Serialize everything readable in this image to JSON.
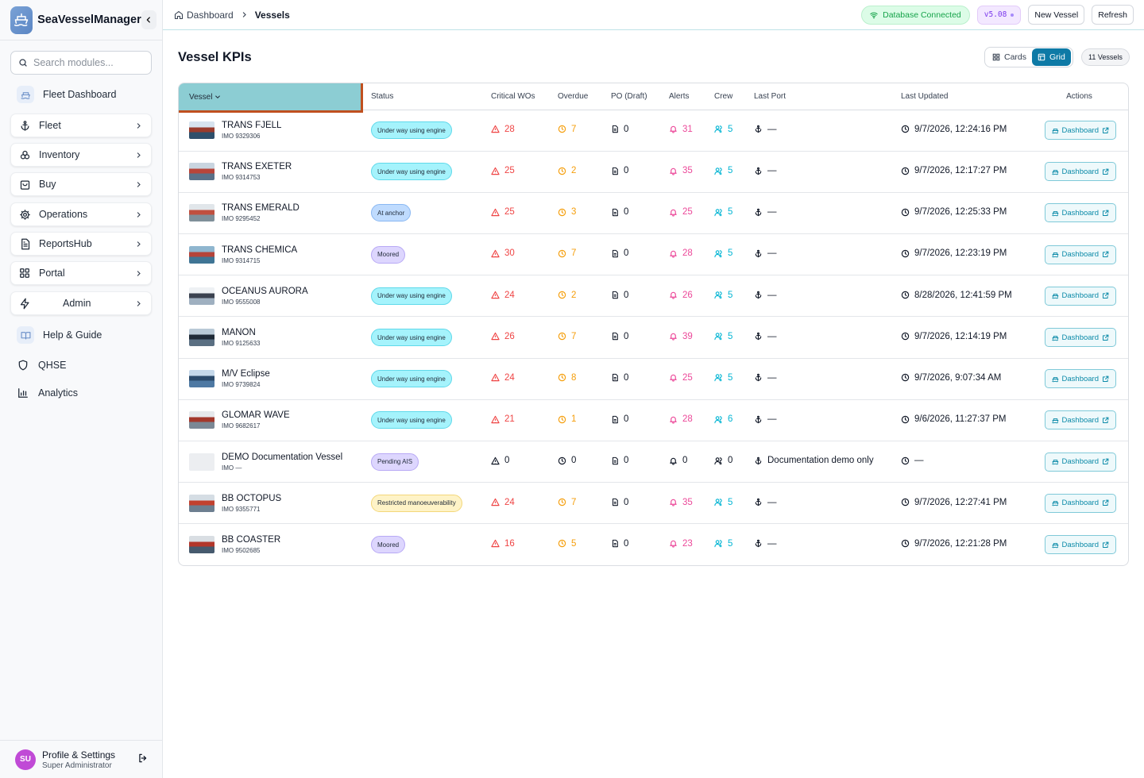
{
  "app": {
    "name": "SeaVesselManager"
  },
  "search": {
    "placeholder": "Search modules..."
  },
  "sidebar": {
    "fleet_dashboard": "Fleet Dashboard",
    "items": [
      {
        "label": "Fleet",
        "icon": "anchor-icon"
      },
      {
        "label": "Inventory",
        "icon": "boxes-icon"
      },
      {
        "label": "Buy",
        "icon": "shopping-bag-icon"
      },
      {
        "label": "Operations",
        "icon": "cog-icon"
      },
      {
        "label": "ReportsHub",
        "icon": "report-icon"
      },
      {
        "label": "Portal",
        "icon": "grid-icon"
      },
      {
        "label": "Admin",
        "icon": "zap-icon"
      }
    ],
    "help": "Help & Guide",
    "qhse": "QHSE",
    "analytics": "Analytics"
  },
  "profile": {
    "initials": "SU",
    "name": "Profile & Settings",
    "role": "Super Administrator"
  },
  "breadcrumb": {
    "home": "Dashboard",
    "current": "Vessels"
  },
  "header": {
    "db_status": "Database Connected",
    "version": "v5.08",
    "new_vessel": "New Vessel",
    "refresh": "Refresh"
  },
  "page": {
    "title": "Vessel KPIs",
    "view_cards": "Cards",
    "view_grid": "Grid",
    "active_view": "Grid",
    "vessel_count": "11 Vessels"
  },
  "table": {
    "columns": {
      "vessel": "Vessel",
      "status": "Status",
      "critical": "Critical WOs",
      "overdue": "Overdue",
      "po": "PO (Draft)",
      "alerts": "Alerts",
      "crew": "Crew",
      "last_port": "Last Port",
      "last_updated": "Last Updated",
      "actions": "Actions"
    },
    "action_label": "Dashboard",
    "rows": [
      {
        "name": "TRANS FJELL",
        "imo": "IMO 9329306",
        "status": "Under way using engine",
        "status_type": "underway",
        "critical": "28",
        "overdue": "7",
        "po": "0",
        "alerts": "31",
        "crew": "5",
        "port": "—",
        "updated": "9/7/2026, 12:24:16 PM",
        "thumb": [
          "#d7e3ee",
          "#9a3b2c",
          "#2f4f6b"
        ]
      },
      {
        "name": "TRANS EXETER",
        "imo": "IMO 9314753",
        "status": "Under way using engine",
        "status_type": "underway",
        "critical": "25",
        "overdue": "2",
        "po": "0",
        "alerts": "35",
        "crew": "5",
        "port": "—",
        "updated": "9/7/2026, 12:17:27 PM",
        "thumb": [
          "#c9d5e0",
          "#b8453a",
          "#5a7189"
        ]
      },
      {
        "name": "TRANS EMERALD",
        "imo": "IMO 9295452",
        "status": "At anchor",
        "status_type": "anchor",
        "critical": "25",
        "overdue": "3",
        "po": "0",
        "alerts": "25",
        "crew": "5",
        "port": "—",
        "updated": "9/7/2026, 12:25:33 PM",
        "thumb": [
          "#e1e6ea",
          "#c0503f",
          "#7f8f99"
        ]
      },
      {
        "name": "TRANS CHEMICA",
        "imo": "IMO 9314715",
        "status": "Moored",
        "status_type": "moored",
        "critical": "30",
        "overdue": "7",
        "po": "0",
        "alerts": "28",
        "crew": "5",
        "port": "—",
        "updated": "9/7/2026, 12:23:19 PM",
        "thumb": [
          "#8fb6cf",
          "#b5443a",
          "#3f7595"
        ]
      },
      {
        "name": "OCEANUS AURORA",
        "imo": "IMO 9555008",
        "status": "Under way using engine",
        "status_type": "underway",
        "critical": "24",
        "overdue": "2",
        "po": "0",
        "alerts": "26",
        "crew": "5",
        "port": "—",
        "updated": "8/28/2026, 12:41:59 PM",
        "thumb": [
          "#eef1f4",
          "#3b4250",
          "#9fb0c0"
        ]
      },
      {
        "name": "MANON",
        "imo": "IMO 9125633",
        "status": "Under way using engine",
        "status_type": "underway",
        "critical": "26",
        "overdue": "7",
        "po": "0",
        "alerts": "39",
        "crew": "5",
        "port": "—",
        "updated": "9/7/2026, 12:14:19 PM",
        "thumb": [
          "#b9c9d6",
          "#1f2a37",
          "#5a6f82"
        ]
      },
      {
        "name": "M/V Eclipse",
        "imo": "IMO 9739824",
        "status": "Under way using engine",
        "status_type": "underway",
        "critical": "24",
        "overdue": "8",
        "po": "0",
        "alerts": "25",
        "crew": "5",
        "port": "—",
        "updated": "9/7/2026, 9:07:34 AM",
        "thumb": [
          "#c5d8ea",
          "#2b4a6b",
          "#4e79a3"
        ]
      },
      {
        "name": "GLOMAR WAVE",
        "imo": "IMO 9682617",
        "status": "Under way using engine",
        "status_type": "underway",
        "critical": "21",
        "overdue": "1",
        "po": "0",
        "alerts": "28",
        "crew": "6",
        "port": "—",
        "updated": "9/6/2026, 11:27:37 PM",
        "thumb": [
          "#e6e9ec",
          "#a3382c",
          "#7b8895"
        ]
      },
      {
        "name": "DEMO Documentation Vessel",
        "imo": "IMO —",
        "status": "Pending AIS",
        "status_type": "pending",
        "critical": "0",
        "overdue": "0",
        "po": "0",
        "alerts": "0",
        "crew": "0",
        "port": "Documentation demo only",
        "updated": "—",
        "thumb": null
      },
      {
        "name": "BB OCTOPUS",
        "imo": "IMO 9355771",
        "status": "Restricted manoeuverability",
        "status_type": "restricted",
        "critical": "24",
        "overdue": "7",
        "po": "0",
        "alerts": "35",
        "crew": "5",
        "port": "—",
        "updated": "9/7/2026, 12:27:41 PM",
        "thumb": [
          "#d5dde4",
          "#c2412f",
          "#6d7f90"
        ]
      },
      {
        "name": "BB COASTER",
        "imo": "IMO 9502685",
        "status": "Moored",
        "status_type": "moored",
        "critical": "16",
        "overdue": "5",
        "po": "0",
        "alerts": "23",
        "crew": "5",
        "port": "—",
        "updated": "9/7/2026, 12:21:28 PM",
        "thumb": [
          "#d9dee3",
          "#b3372b",
          "#465a6e"
        ]
      }
    ]
  },
  "colors": {
    "accent": "#0e7aa6",
    "critical": "#ef4444",
    "overdue": "#f59e0b",
    "alerts": "#ec4899",
    "crew": "#06b6d4",
    "db_connected": "#16a34a"
  }
}
